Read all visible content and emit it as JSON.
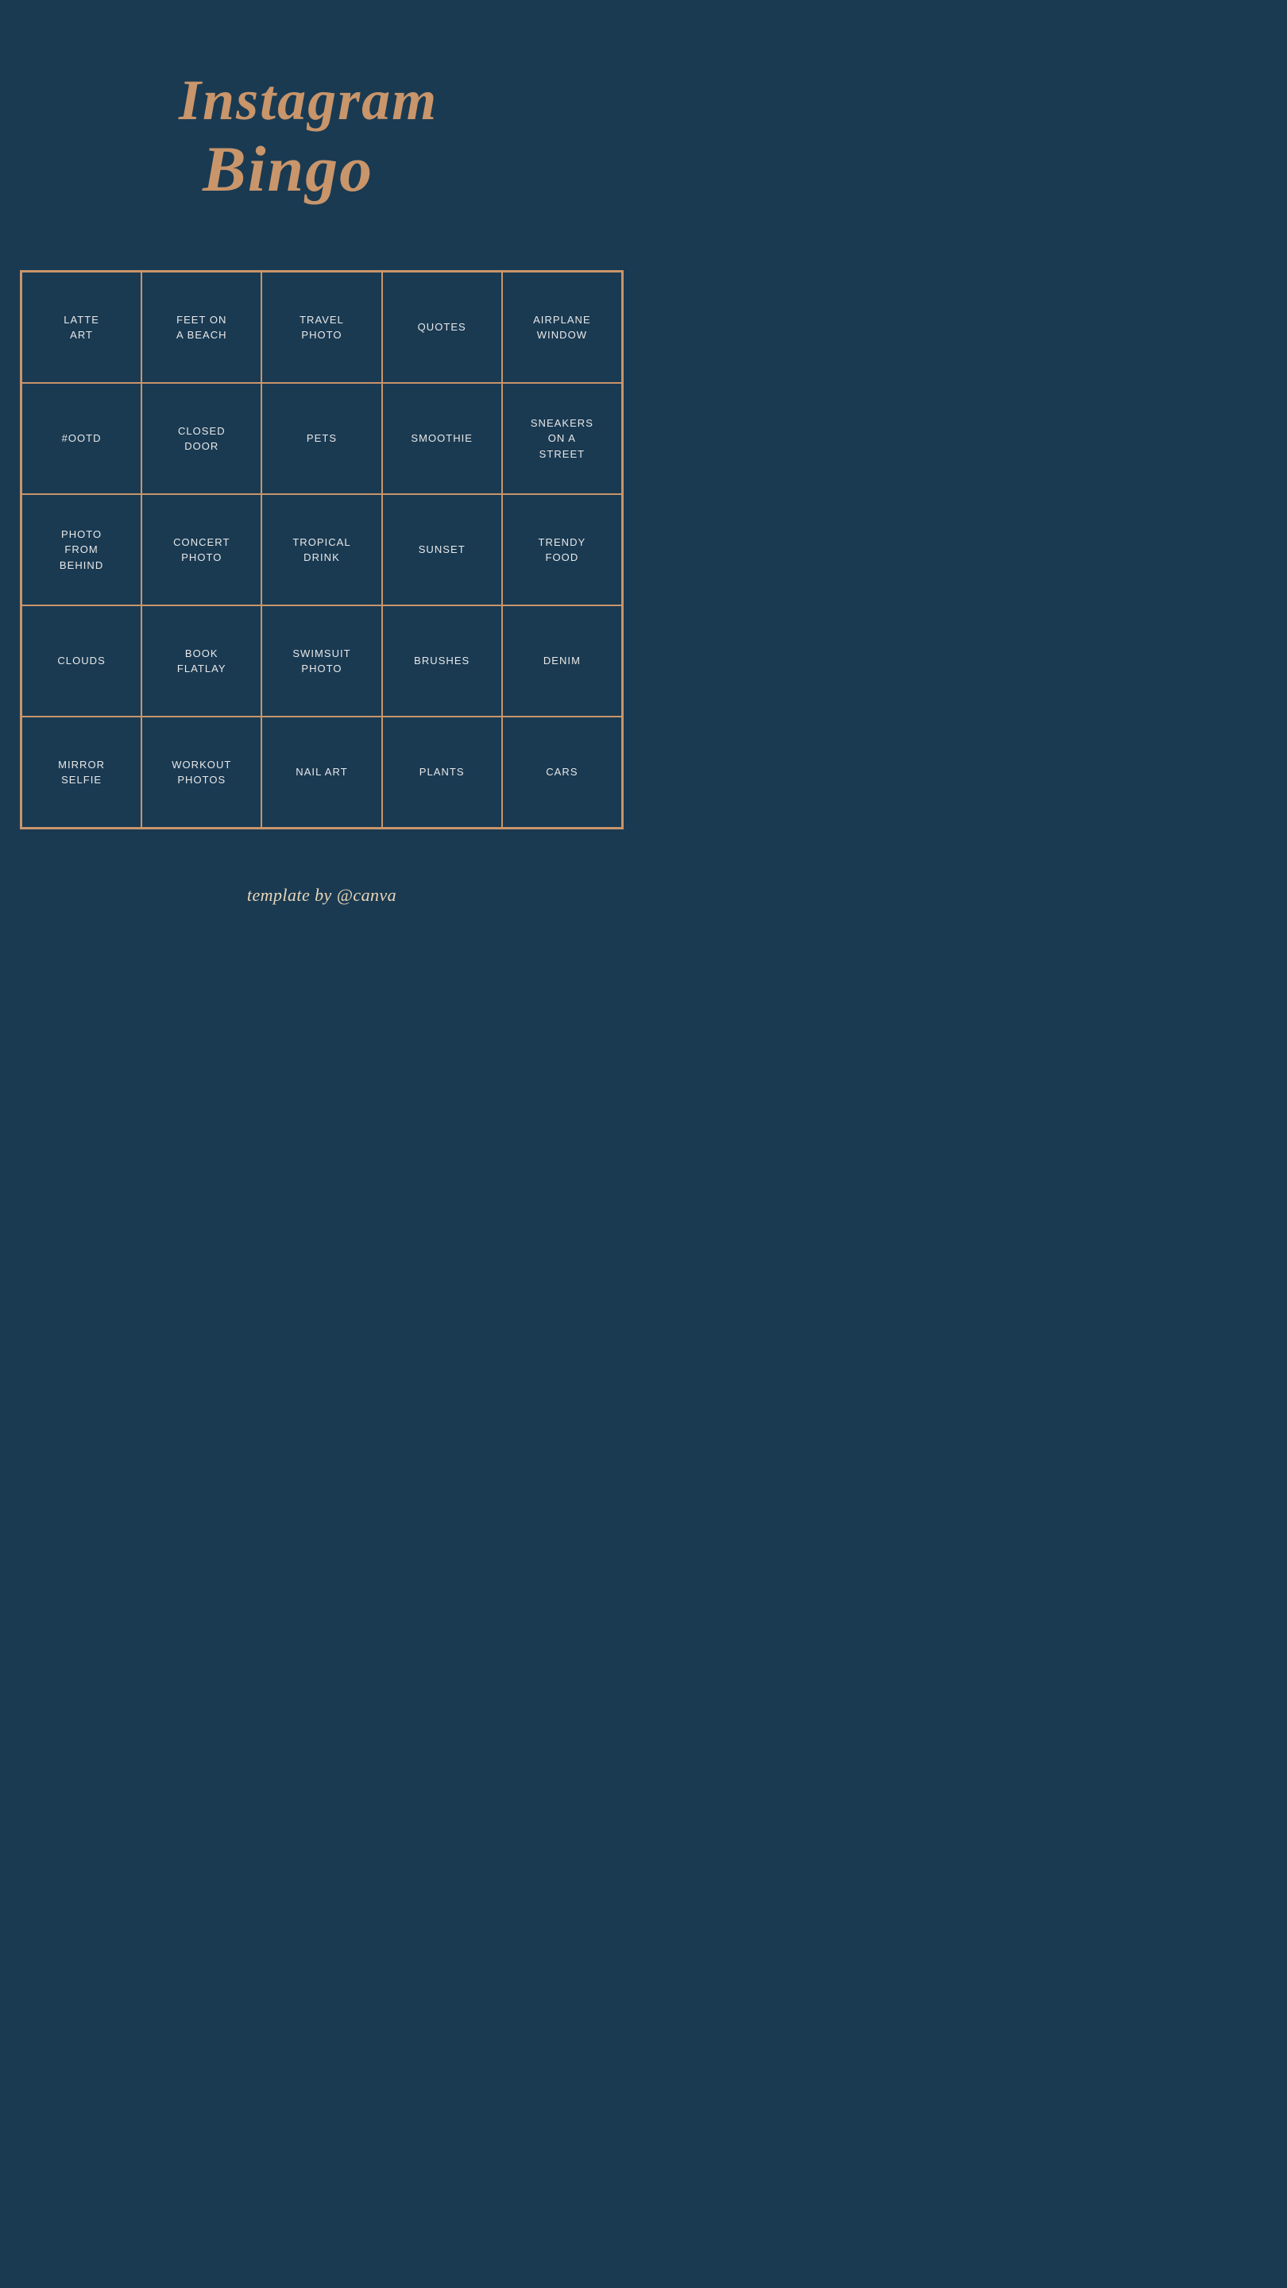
{
  "header": {
    "title": "Instagram Bingo"
  },
  "grid": {
    "cells": [
      {
        "label": "LATTE\nART"
      },
      {
        "label": "FEET ON\nA BEACH"
      },
      {
        "label": "TRAVEL\nPHOTO"
      },
      {
        "label": "QUOTES"
      },
      {
        "label": "AIRPLANE\nWINDOW"
      },
      {
        "label": "#OOTD"
      },
      {
        "label": "CLOSED\nDOOR"
      },
      {
        "label": "PETS"
      },
      {
        "label": "SMOOTHIE"
      },
      {
        "label": "SNEAKERS\nON A\nSTREET"
      },
      {
        "label": "PHOTO\nFROM\nBEHIND"
      },
      {
        "label": "CONCERT\nPHOTO"
      },
      {
        "label": "TROPICAL\nDRINK"
      },
      {
        "label": "SUNSET"
      },
      {
        "label": "TRENDY\nFOOD"
      },
      {
        "label": "CLOUDS"
      },
      {
        "label": "BOOK\nFLATLAY"
      },
      {
        "label": "SWIMSUIT\nPHOTO"
      },
      {
        "label": "BRUSHES"
      },
      {
        "label": "DENIM"
      },
      {
        "label": "MIRROR\nSELFIE"
      },
      {
        "label": "WORKOUT\nPHOTOS"
      },
      {
        "label": "NAIL ART"
      },
      {
        "label": "PLANTS"
      },
      {
        "label": "CARS"
      }
    ]
  },
  "footer": {
    "text": "template by @canva"
  }
}
